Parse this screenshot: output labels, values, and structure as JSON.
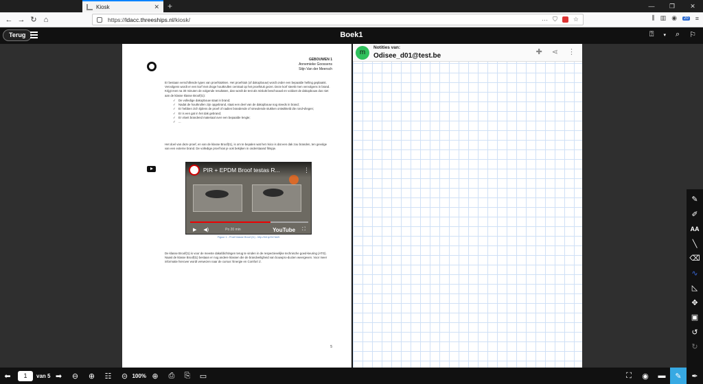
{
  "browser": {
    "tab_title": "Kiosk",
    "url_prefix": "https://",
    "url_domain": "ldacc.threeships.nl",
    "url_path": "/kiosk/",
    "badge_count": "20"
  },
  "app": {
    "back_label": "Terug",
    "title": "Boek1"
  },
  "document": {
    "header_line1": "GEBOUWEN 1",
    "header_line2": "Annemieke Goossens",
    "header_line3": "Stijn Van der Meersch",
    "paragraph1": "Er bestaan verschillende types van proefstukken. Het proefstuk (of dakopbouw) wordt onder een bepaalde helling geplaatst. Vervolgens wordt er een korf met droge houtkrullen centraal op het proefstuk gezet. Deze korf steekt men vervolgens in brand. Krijgt men na 30 minuten de volgende resultaten, dan wordt de test als mislukt beschouwd en voldoet de dakopbouw dus niet aan de klasse klasse Broof(t1):",
    "bullets": [
      "De volledige dakopbouw staat in brand;",
      "Nadat de houtkrullen zijn opgebrand, staat een deel van de dakopbouw nog steeds in brand;",
      "Er hebben zich tijdens de proef of nadien brandende of smeulende stukken ontwikkeld die rond-vliegen;",
      "Er is een gat in het dak gebrand;",
      "Er vloeit brandend materiaal over een bepaalde lengte;",
      "..."
    ],
    "paragraph2": "Het doel van deze proef, en van de klasse Broof(t1), is om te bepalen wat het risico is dat een dak zou branden, ten gevolge van een externe brand. De volledige proef kan je ook bekijken in onderstaand filmpje.",
    "video_title": "PIR + EPDM Broof testas R...",
    "video_time": "Po 20 min",
    "video_brand": "YouTube",
    "video_progress_pct": 68,
    "caption": "Figuur 1 - Proef klasse Broof (t1) - http://bit.ly/2b7dd2t",
    "paragraph3": "De klasse Broof(t1) is voor de meeste dakafdichtingen terug te vinden in de respectievelijke technische goed-keuring (ATG). Naast de klasse Broof(t1) bestaan er nog andere klassen die de brandveiligheid van bouwpro-ducten weergeven. Voor meer informatie hierover wordt verwezen naar de cursus 'Energie en Comfort 1'.",
    "page_number": "5"
  },
  "notes": {
    "avatar_letter": "m",
    "label": "Notities van:",
    "user": "Odisee_d01@test.be"
  },
  "footer": {
    "page_value": "1",
    "page_total": "van 5",
    "zoom": "100%"
  },
  "colors": {
    "accent": "#37a9e3",
    "avatar": "#2fc05c",
    "active_tool": "#3a6ae0"
  }
}
